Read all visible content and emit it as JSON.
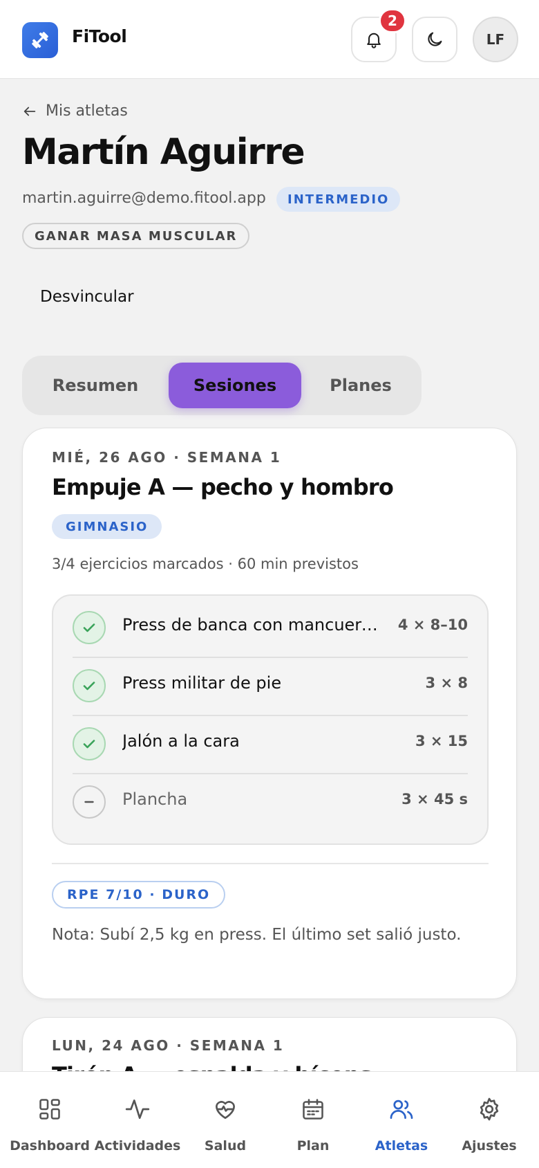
{
  "app": {
    "name": "FiTool",
    "notification_count": "2",
    "avatar_initials": "LF"
  },
  "colors": {
    "accent": "#8b5cdb",
    "blue": "#2b63c9",
    "badge": "#e0343f",
    "success": "#3aa35a"
  },
  "athlete": {
    "back_label": "Mis atletas",
    "name": "Martín Aguirre",
    "email": "martin.aguirre@demo.fitool.app",
    "level": "INTERMEDIO",
    "goal": "GANAR MASA MUSCULAR",
    "unlink_label": "Desvincular"
  },
  "tabs": [
    {
      "label": "Resumen",
      "active": false
    },
    {
      "label": "Sesiones",
      "active": true
    },
    {
      "label": "Planes",
      "active": false
    }
  ],
  "sessions": [
    {
      "date": "MIÉ, 26 AGO · SEMANA 1",
      "title": "Empuje A — pecho y hombro",
      "type": "GIMNASIO",
      "meta": "3/4 ejercicios marcados · 60 min previstos",
      "exercises": [
        {
          "name": "Press de banca con mancuernas",
          "sets": "4 × 8–10",
          "done": true
        },
        {
          "name": "Press militar de pie",
          "sets": "3 × 8",
          "done": true
        },
        {
          "name": "Jalón a la cara",
          "sets": "3 × 15",
          "done": true
        },
        {
          "name": "Plancha",
          "sets": "3 × 45 s",
          "done": false
        }
      ],
      "rpe": "RPE 7/10 · DURO",
      "note": "Nota: Subí 2,5 kg en press. El último set salió justo."
    },
    {
      "date": "LUN, 24 AGO · SEMANA 1",
      "title": "Tirón A — espalda y bíceps"
    }
  ],
  "nav": [
    {
      "label": "Dashboard",
      "icon": "dashboard-icon",
      "active": false
    },
    {
      "label": "Actividades",
      "icon": "activity-icon",
      "active": false
    },
    {
      "label": "Salud",
      "icon": "heart-pulse-icon",
      "active": false
    },
    {
      "label": "Plan",
      "icon": "calendar-icon",
      "active": false
    },
    {
      "label": "Atletas",
      "icon": "users-icon",
      "active": true
    },
    {
      "label": "Ajustes",
      "icon": "gear-icon",
      "active": false
    }
  ]
}
